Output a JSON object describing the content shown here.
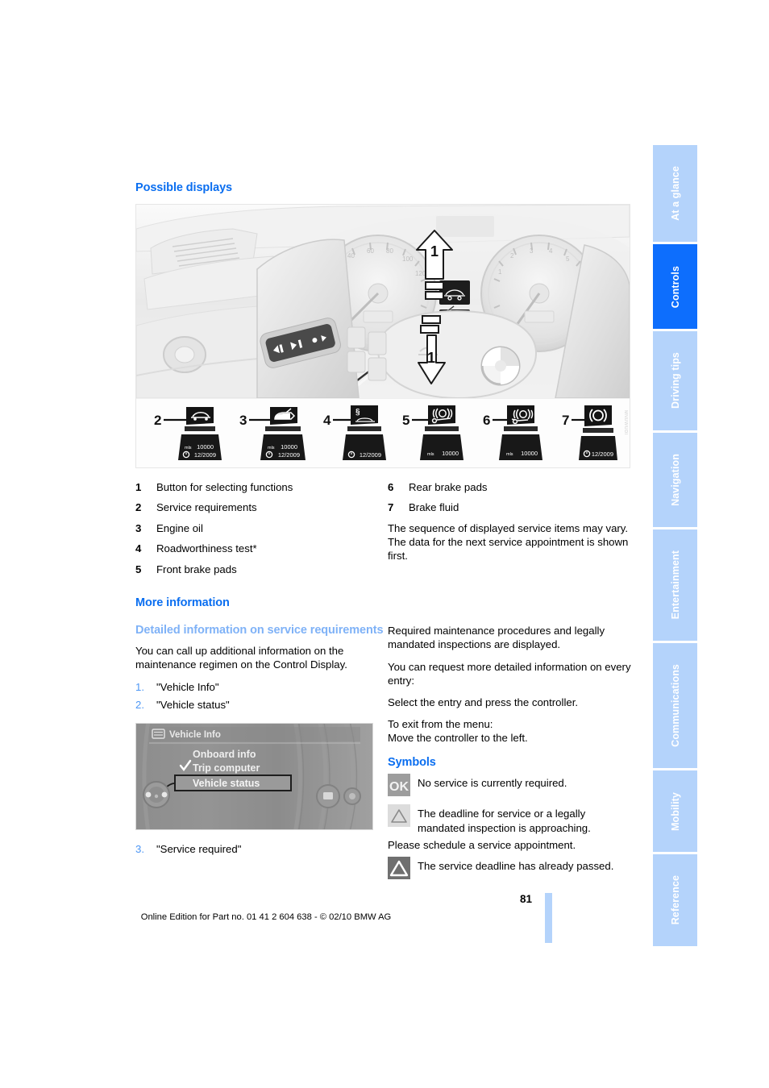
{
  "page": {
    "number": "81",
    "footer_text": "Online Edition for Part no. 01 41 2 604 638 - © 02/10 BMW AG",
    "figure_watermark": "MNUWUDI"
  },
  "sidebar": {
    "tabs": [
      {
        "label": "At a glance",
        "active": false
      },
      {
        "label": "Controls",
        "active": true
      },
      {
        "label": "Driving tips",
        "active": false
      },
      {
        "label": "Navigation",
        "active": false
      },
      {
        "label": "Entertainment",
        "active": false
      },
      {
        "label": "Communications",
        "active": false
      },
      {
        "label": "Mobility",
        "active": false
      },
      {
        "label": "Reference",
        "active": false
      }
    ],
    "colors": {
      "inactive": "#b4d3fb",
      "active": "#0d6efd",
      "label": "#ffffff"
    }
  },
  "headings": {
    "possible_displays": "Possible displays",
    "more_information": "More information",
    "detailed_information": "Detailed information on service requirements",
    "symbols": "Symbols"
  },
  "colors": {
    "heading_blue": "#0a6ef0",
    "subheading_blue": "#7fb2f7",
    "step_number_blue": "#4d97f5"
  },
  "legend": {
    "left": [
      {
        "num": "1",
        "text": "Button for selecting functions"
      },
      {
        "num": "2",
        "text": "Service requirements"
      },
      {
        "num": "3",
        "text": "Engine oil"
      },
      {
        "num": "4",
        "text": "Roadworthiness test*"
      },
      {
        "num": "5",
        "text": "Front brake pads"
      }
    ],
    "right": [
      {
        "num": "6",
        "text": "Rear brake pads"
      },
      {
        "num": "7",
        "text": "Brake fluid"
      }
    ],
    "note": "The sequence of displayed service items may vary. The data for the next service appointment is shown first."
  },
  "figure": {
    "callout_arrow_label": "1",
    "display_icons": [
      {
        "num": "2",
        "icon": "service-requirements-icon",
        "unit": "mls",
        "distance": "10000",
        "date": "12/2009"
      },
      {
        "num": "3",
        "icon": "engine-oil-can-icon",
        "unit": "mls",
        "distance": "10000",
        "date": "12/2009"
      },
      {
        "num": "4",
        "icon": "roadworthiness-test-icon",
        "unit": "",
        "distance": "",
        "date": "12/2009"
      },
      {
        "num": "5",
        "icon": "front-brake-pads-icon",
        "unit": "mls",
        "distance": "10000",
        "date": ""
      },
      {
        "num": "6",
        "icon": "rear-brake-pads-icon",
        "unit": "mls",
        "distance": "10000",
        "date": ""
      },
      {
        "num": "7",
        "icon": "brake-fluid-icon",
        "unit": "",
        "distance": "",
        "date": "12/2009"
      }
    ]
  },
  "detailed_info": {
    "intro": "You can call up additional information on the maintenance regimen on the Control Display.",
    "steps": [
      {
        "num": "1.",
        "text": "\"Vehicle Info\""
      },
      {
        "num": "2.",
        "text": "\"Vehicle status\""
      },
      {
        "num": "3.",
        "text": "\"Service required\""
      }
    ]
  },
  "control_display": {
    "header_title": "Vehicle Info",
    "header_icon": "vehicle-info-icon",
    "menu_items": [
      {
        "label": "Onboard info",
        "checked": false,
        "highlighted": false
      },
      {
        "label": "Trip computer",
        "checked": true,
        "highlighted": false
      },
      {
        "label": "Vehicle status",
        "checked": false,
        "highlighted": true
      }
    ]
  },
  "right_column": {
    "paragraphs": [
      "Required maintenance procedures and legally mandated inspections are displayed.",
      "You can request more detailed information on every entry:",
      "Select the entry and press the controller.",
      "To exit from the menu:\nMove the controller to the left."
    ]
  },
  "symbols": [
    {
      "icon": "ok-badge-icon",
      "text": "No service is currently required.",
      "extra": ""
    },
    {
      "icon": "warning-triangle-light-icon",
      "text": "The deadline for service or a legally mandated inspection is approaching.",
      "extra": "Please schedule a service appointment."
    },
    {
      "icon": "warning-triangle-dark-icon",
      "text": "The service deadline has already passed.",
      "extra": ""
    }
  ]
}
